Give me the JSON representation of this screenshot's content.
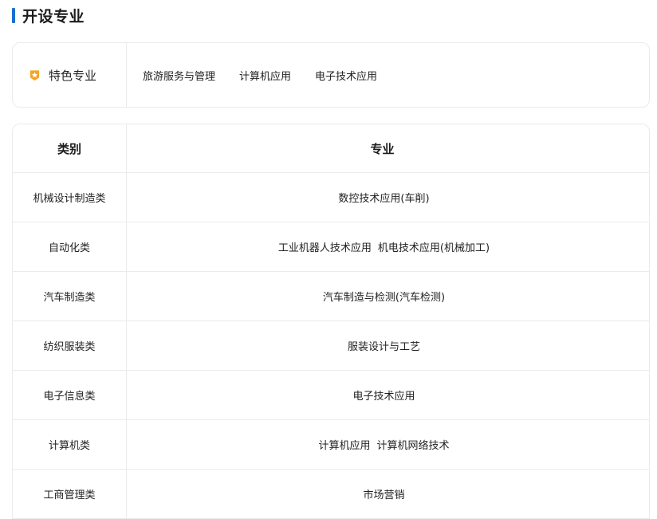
{
  "section": {
    "title": "开设专业"
  },
  "featured": {
    "label": "特色专业",
    "icon": "star-badge-icon",
    "accent_color": "#f5a623",
    "items": [
      "旅游服务与管理",
      "计算机应用",
      "电子技术应用"
    ]
  },
  "table": {
    "headers": {
      "category": "类别",
      "major": "专业"
    },
    "rows": [
      {
        "category": "机械设计制造类",
        "majors": [
          "数控技术应用(车削)"
        ]
      },
      {
        "category": "自动化类",
        "majors": [
          "工业机器人技术应用",
          "机电技术应用(机械加工)"
        ]
      },
      {
        "category": "汽车制造类",
        "majors": [
          "汽车制造与检测(汽车检测)"
        ]
      },
      {
        "category": "纺织服装类",
        "majors": [
          "服装设计与工艺"
        ]
      },
      {
        "category": "电子信息类",
        "majors": [
          "电子技术应用"
        ]
      },
      {
        "category": "计算机类",
        "majors": [
          "计算机应用",
          "计算机网络技术"
        ]
      },
      {
        "category": "工商管理类",
        "majors": [
          "市场营销"
        ]
      }
    ]
  },
  "colors": {
    "accent": "#1a6fd4",
    "border": "#ebebeb",
    "text": "#222222"
  }
}
